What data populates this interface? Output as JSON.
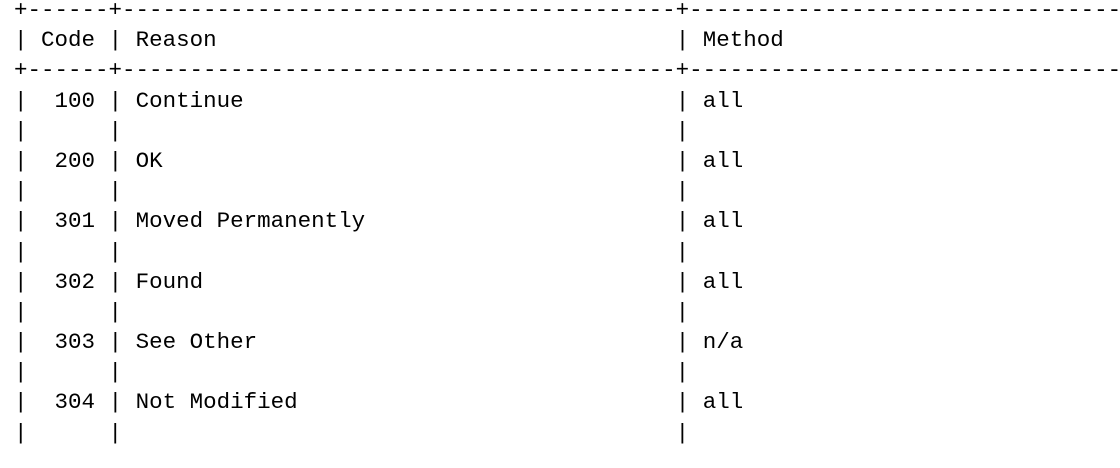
{
  "table": {
    "columns": [
      "Code",
      "Reason",
      "Method"
    ],
    "rows": [
      [
        "100",
        "Continue",
        "all"
      ],
      [
        "200",
        "OK",
        "all"
      ],
      [
        "301",
        "Moved Permanently",
        "all"
      ],
      [
        "302",
        "Found",
        "all"
      ],
      [
        "303",
        "See Other",
        "n/a"
      ],
      [
        "304",
        "Not Modified",
        "all"
      ]
    ]
  }
}
